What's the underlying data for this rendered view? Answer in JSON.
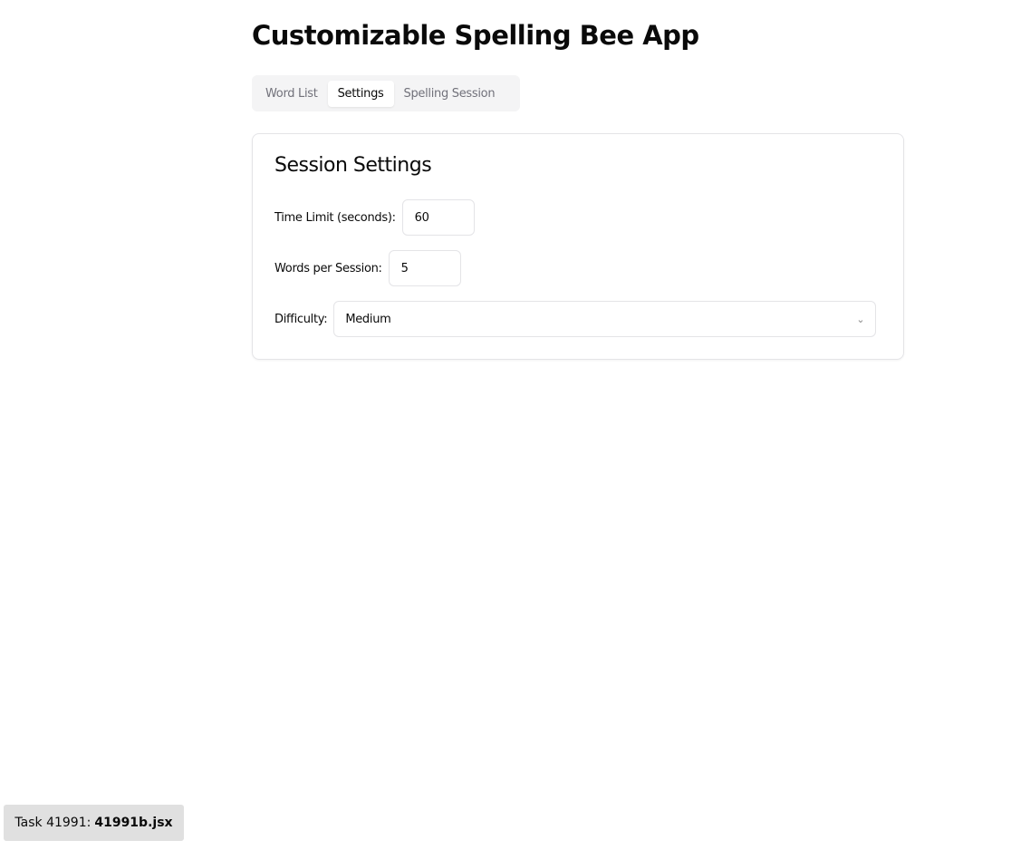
{
  "header": {
    "title": "Customizable Spelling Bee App"
  },
  "tabs": [
    {
      "label": "Word List",
      "active": false
    },
    {
      "label": "Settings",
      "active": true
    },
    {
      "label": "Spelling Session",
      "active": false
    }
  ],
  "settings": {
    "heading": "Session Settings",
    "time_limit": {
      "label": "Time Limit (seconds):",
      "value": "60"
    },
    "words_per_session": {
      "label": "Words per Session:",
      "value": "5"
    },
    "difficulty": {
      "label": "Difficulty:",
      "value": "Medium",
      "icon": "chevron-down-icon"
    }
  },
  "footer": {
    "prefix": "Task 41991:",
    "file": "41991b.jsx"
  }
}
